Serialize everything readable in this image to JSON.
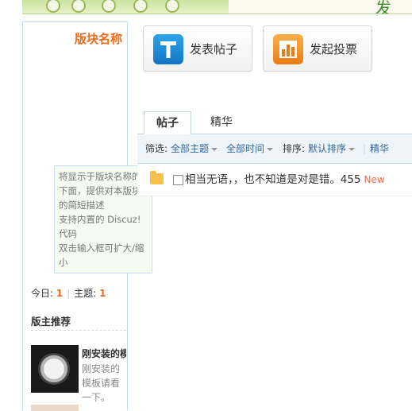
{
  "header": {
    "banner_text": "发 上"
  },
  "sidebar": {
    "forum_name": "版块名称",
    "tip_lines": [
      "将显示于版块名称的下面，提供对本版块的简短描述",
      "支持内置的 Discuz! 代码",
      "双击输入框可扩大/缩小"
    ],
    "stats": {
      "today_label": "今日:",
      "today_value": "1",
      "topics_label": "主题:",
      "topics_value": "1"
    },
    "recommend_title": "版主推荐",
    "recommend_item": {
      "title": "刚安装的模板",
      "desc": "刚安装的模板请看一下。"
    }
  },
  "actions": {
    "new_post": "发表帖子",
    "new_poll": "发起投票"
  },
  "tabs": [
    {
      "label": "帖子",
      "active": true
    },
    {
      "label": "精华",
      "active": false
    }
  ],
  "filter": {
    "label": "筛选:",
    "all_topics": "全部主题",
    "all_time": "全部时间",
    "sort_label": "排序:",
    "sort_value": "默认排序",
    "digest": "精华"
  },
  "threads": [
    {
      "title": "相当无语，，也不知道是对是错。455",
      "badge": "New"
    }
  ],
  "colors": {
    "accent_orange": "#ee6a1c",
    "link_blue": "#336699",
    "border_blue": "#c2d5e3",
    "new_badge": "#f26c4f"
  }
}
